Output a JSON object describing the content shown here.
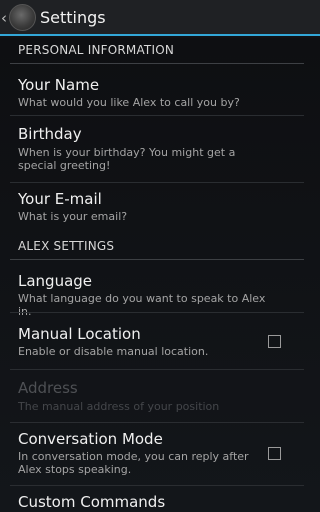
{
  "actionbar": {
    "title": "Settings",
    "up_glyph": "‹",
    "app_icon": "app-logo-icon"
  },
  "sections": {
    "personal": "PERSONAL INFORMATION",
    "alex": "ALEX SETTINGS"
  },
  "prefs": {
    "name": {
      "title": "Your Name",
      "summary": "What would you like Alex to call you by?"
    },
    "birthday": {
      "title": "Birthday",
      "summary": "When is your birthday? You might get a special greeting!"
    },
    "email": {
      "title": "Your E-mail",
      "summary": "What is your email?"
    },
    "language": {
      "title": "Language",
      "summary": "What language do you want to speak to Alex in."
    },
    "manual_location": {
      "title": "Manual Location",
      "summary": "Enable or disable manual location.",
      "checked": false
    },
    "address": {
      "title": "Address",
      "summary": "The manual address of your position",
      "enabled": false
    },
    "conversation_mode": {
      "title": "Conversation Mode",
      "summary": "In conversation mode, you can reply after Alex stops speaking.",
      "checked": false
    },
    "custom_commands": {
      "title": "Custom Commands"
    }
  },
  "colors": {
    "accent": "#33a7d8",
    "background": "#101215"
  }
}
